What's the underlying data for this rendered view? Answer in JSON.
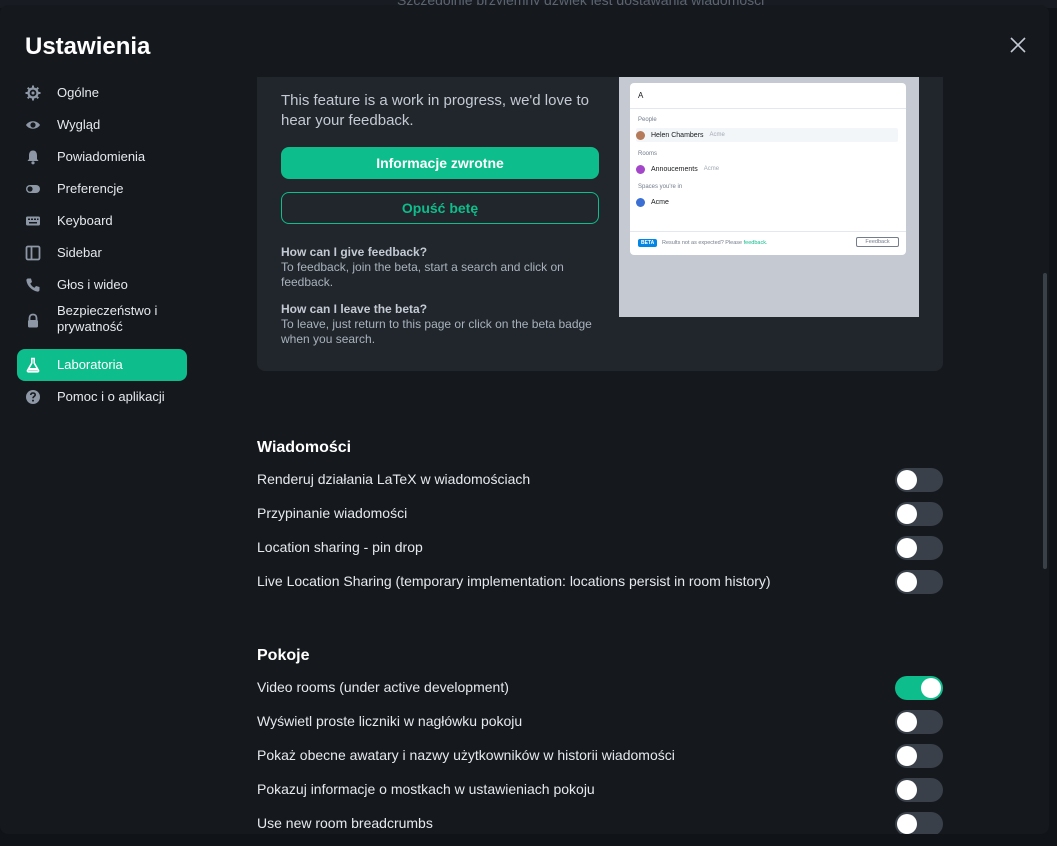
{
  "backdrop": {
    "partial_text": "Szczególnie przyjemny dźwięk jest dostawania wiadomości"
  },
  "dialog": {
    "title": "Ustawienia"
  },
  "sidebar": {
    "items": [
      {
        "label": "Ogólne",
        "icon": "gear-icon",
        "active": false
      },
      {
        "label": "Wygląd",
        "icon": "eye-icon",
        "active": false
      },
      {
        "label": "Powiadomienia",
        "icon": "bell-icon",
        "active": false
      },
      {
        "label": "Preferencje",
        "icon": "toggle-icon",
        "active": false
      },
      {
        "label": "Keyboard",
        "icon": "keyboard-icon",
        "active": false
      },
      {
        "label": "Sidebar",
        "icon": "sidebar-icon",
        "active": false
      },
      {
        "label": "Głos i wideo",
        "icon": "phone-icon",
        "active": false
      },
      {
        "label": "Bezpieczeństwo i prywatność",
        "icon": "lock-icon",
        "active": false
      },
      {
        "label": "Laboratoria",
        "icon": "flask-icon",
        "active": true
      },
      {
        "label": "Pomoc i o aplikacji",
        "icon": "help-icon",
        "active": false
      }
    ]
  },
  "beta": {
    "description": "This feature is a work in progress, we'd love to hear your feedback.",
    "feedback_button": "Informacje zwrotne",
    "leave_button": "Opuść betę",
    "faq": [
      {
        "q": "How can I give feedback?",
        "a": "To feedback, join the beta, start a search and click on feedback."
      },
      {
        "q": "How can I leave the beta?",
        "a": "To leave, just return to this page or click on the beta badge when you search."
      }
    ],
    "preview": {
      "search_text": "A",
      "people_heading": "People",
      "person_name": "Helen Chambers",
      "person_sub": "Acme",
      "rooms_heading": "Rooms",
      "room_name": "Annoucements",
      "room_sub": "Acme",
      "spaces_heading": "Spaces you're in",
      "space_name": "Acme",
      "badge": "BETA",
      "notice": "Results not as expected? Please",
      "notice_link": "feedback.",
      "feedback_btn": "Feedback"
    }
  },
  "messages_section": {
    "title": "Wiadomości",
    "rows": [
      {
        "label": "Renderuj działania LaTeX w wiadomościach",
        "on": false
      },
      {
        "label": "Przypinanie wiadomości",
        "on": false
      },
      {
        "label": "Location sharing - pin drop",
        "on": false
      },
      {
        "label": "Live Location Sharing (temporary implementation: locations persist in room history)",
        "on": false
      }
    ]
  },
  "rooms_section": {
    "title": "Pokoje",
    "rows": [
      {
        "label": "Video rooms (under active development)",
        "on": true
      },
      {
        "label": "Wyświetl proste liczniki w nagłówku pokoju",
        "on": false
      },
      {
        "label": "Pokaż obecne awatary i nazwy użytkowników w historii wiadomości",
        "on": false
      },
      {
        "label": "Pokazuj informacje o mostkach w ustawieniach pokoju",
        "on": false
      },
      {
        "label": "Use new room breadcrumbs",
        "on": false
      }
    ]
  },
  "colors": {
    "accent": "#0dbd8b",
    "panel": "#15191e",
    "card": "#21262c"
  }
}
